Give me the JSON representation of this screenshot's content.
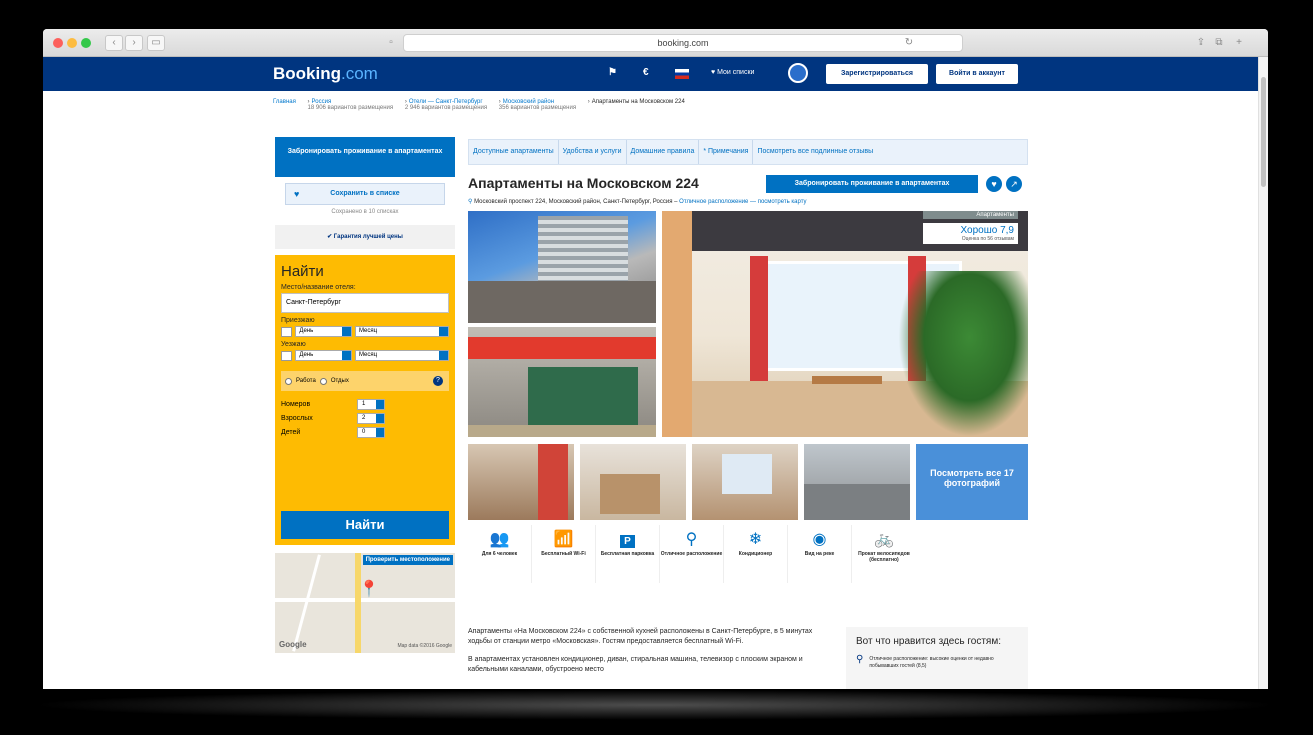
{
  "browser": {
    "url": "booking.com",
    "back_icon": "chevron-left-icon",
    "forward_icon": "chevron-right-icon"
  },
  "header": {
    "logo_main": "Booking",
    "logo_suffix": ".com",
    "currency": "€",
    "my_lists": "♥ Мои списки",
    "register_button": "Зарегистрироваться",
    "login_button": "Войти в аккаунт"
  },
  "breadcrumbs": [
    {
      "label": "Главная",
      "sub": ""
    },
    {
      "label": "Россия",
      "sub": "18 906 вариантов размещения"
    },
    {
      "label": "Отели — Санкт-Петербург",
      "sub": "2 946 вариантов размещения"
    },
    {
      "label": "Московский район",
      "sub": "356 вариантов размещения"
    },
    {
      "label": "Апартаменты на Московском 224",
      "sub": ""
    }
  ],
  "sidebar": {
    "book_button": "Забронировать проживание в апартаментах",
    "save_button": "Сохранить в списке",
    "saved_note": "Сохранено в 10 списках",
    "guarantee": "Гарантия лучшей цены"
  },
  "search": {
    "title": "Найти",
    "destination_label": "Место/название отеля:",
    "destination_value": "Санкт-Петербург",
    "checkin_label": "Приезжаю",
    "checkout_label": "Уезжаю",
    "day_placeholder": "День",
    "month_placeholder": "Месяц",
    "purpose_work": "Работа",
    "purpose_leisure": "Отдых",
    "rooms_label": "Номеров",
    "adults_label": "Взрослых",
    "children_label": "Детей",
    "rooms_value": "1",
    "adults_value": "2",
    "children_value": "0",
    "submit": "Найти"
  },
  "map": {
    "show_button": "Проверить местоположение",
    "google": "Google",
    "attribution": "Map data ©2016 Google"
  },
  "tabs": [
    "Доступные апартаменты",
    "Удобства и услуги",
    "Домашние правила",
    "* Примечания",
    "Посмотреть все подлинные отзывы"
  ],
  "property": {
    "title": "Апартаменты на Московском 224",
    "book_button": "Забронировать проживание в апартаментах",
    "address": "Московский проспект 224, Московский район, Санкт-Петербург, Россия –",
    "location_link": "Отличное расположение — посмотреть карту"
  },
  "rating": {
    "category": "Апартаменты",
    "score_text": "Хорошо 7,9",
    "reviews": "Оценка по 56 отзывам"
  },
  "gallery": {
    "more_photos": "Посмотреть все 17 фотографий"
  },
  "facilities": [
    {
      "icon": "people-icon",
      "label": "Для 6 человек"
    },
    {
      "icon": "wifi-icon",
      "label": "Бесплатный Wi-Fi"
    },
    {
      "icon": "parking-icon",
      "label": "Бесплатная парковка"
    },
    {
      "icon": "location-pin-icon",
      "label": "Отличное расположение"
    },
    {
      "icon": "snowflake-icon",
      "label": "Кондиционер"
    },
    {
      "icon": "eye-icon",
      "label": "Вид на реке"
    },
    {
      "icon": "bicycle-icon",
      "label": "Прокат велосипедов (бесплатно)"
    }
  ],
  "description": {
    "p1": "Апартаменты «На Московском 224» с собственной кухней расположены в Санкт-Петербурге, в 5 минутах ходьбы от станции метро «Московская». Гостям предоставляется бесплатный Wi-Fi.",
    "p2": "В апартаментах установлен кондиционер, диван, стиральная машина, телевизор с плоским экраном и кабельными каналами, обустроено место"
  },
  "likes": {
    "title": "Вот что нравится здесь гостям:",
    "item1": "Отличное расположение: высокие оценки от недавно побывавших гостей (8,5)"
  },
  "colors": {
    "brand": "#003580",
    "accent": "#0071c2",
    "search_bg": "#febb02"
  }
}
